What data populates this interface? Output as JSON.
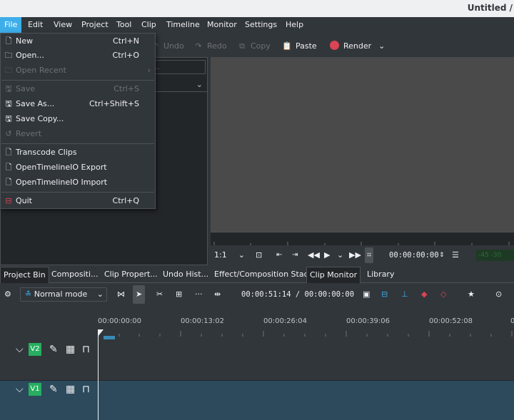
{
  "window": {
    "title": "Untitled /"
  },
  "menubar": [
    {
      "label": "File",
      "active": true
    },
    {
      "label": "Edit"
    },
    {
      "label": "View"
    },
    {
      "label": "Project"
    },
    {
      "label": "Tool"
    },
    {
      "label": "Clip"
    },
    {
      "label": "Timeline"
    },
    {
      "label": "Monitor"
    },
    {
      "label": "Settings"
    },
    {
      "label": "Help"
    }
  ],
  "toolbar": {
    "undo": "Undo",
    "redo": "Redo",
    "copy": "Copy",
    "paste": "Paste",
    "render": "Render",
    "search_placeholder": "..."
  },
  "file_menu": {
    "items": [
      {
        "label": "New",
        "shortcut": "Ctrl+N",
        "icon": "new-file-icon",
        "enabled": true
      },
      {
        "label": "Open...",
        "shortcut": "Ctrl+O",
        "icon": "open-folder-icon",
        "enabled": true
      },
      {
        "label": "Open Recent",
        "shortcut": "",
        "icon": "open-recent-icon",
        "enabled": false,
        "submenu": true
      },
      {
        "label": "Save",
        "shortcut": "Ctrl+S",
        "icon": "save-icon",
        "enabled": false
      },
      {
        "label": "Save As...",
        "shortcut": "Ctrl+Shift+S",
        "icon": "save-as-icon",
        "enabled": true
      },
      {
        "label": "Save Copy...",
        "shortcut": "",
        "icon": "save-copy-icon",
        "enabled": true
      },
      {
        "label": "Revert",
        "shortcut": "",
        "icon": "revert-icon",
        "enabled": false
      },
      {
        "label": "Transcode Clips",
        "shortcut": "",
        "icon": "transcode-icon",
        "enabled": true
      },
      {
        "label": "OpenTimelineIO Export",
        "shortcut": "",
        "icon": "otio-export-icon",
        "enabled": true
      },
      {
        "label": "OpenTimelineIO Import",
        "shortcut": "",
        "icon": "otio-import-icon",
        "enabled": true
      },
      {
        "label": "Quit",
        "shortcut": "Ctrl+Q",
        "icon": "quit-icon",
        "enabled": true,
        "color": "#da4453"
      }
    ]
  },
  "monitor": {
    "zoom": "1:1",
    "timecode": "00:00:00:00",
    "meter": "-45 -30"
  },
  "tabs": [
    {
      "label": "Project Bin",
      "active": true
    },
    {
      "label": "Compositi..."
    },
    {
      "label": "Clip Propert..."
    },
    {
      "label": "Undo Hist..."
    },
    {
      "label": "Effect/Composition Stack"
    },
    {
      "label": "Clip Monitor",
      "active": true
    },
    {
      "label": "Library"
    }
  ],
  "timeline": {
    "mode": "Normal mode",
    "timecode": "00:00:51:14 / 00:00:00:00",
    "ruler": [
      "00:00:00:00",
      "00:00:13:02",
      "00:00:26:04",
      "00:00:39:06",
      "00:00:52:08",
      "0"
    ],
    "tracks": [
      {
        "name": "V2",
        "color": "#27ae60"
      },
      {
        "name": "V1",
        "color": "#27ae60"
      }
    ],
    "colors": {
      "v1_track": "#2c4a5c",
      "v2_track": "#31363b"
    }
  }
}
